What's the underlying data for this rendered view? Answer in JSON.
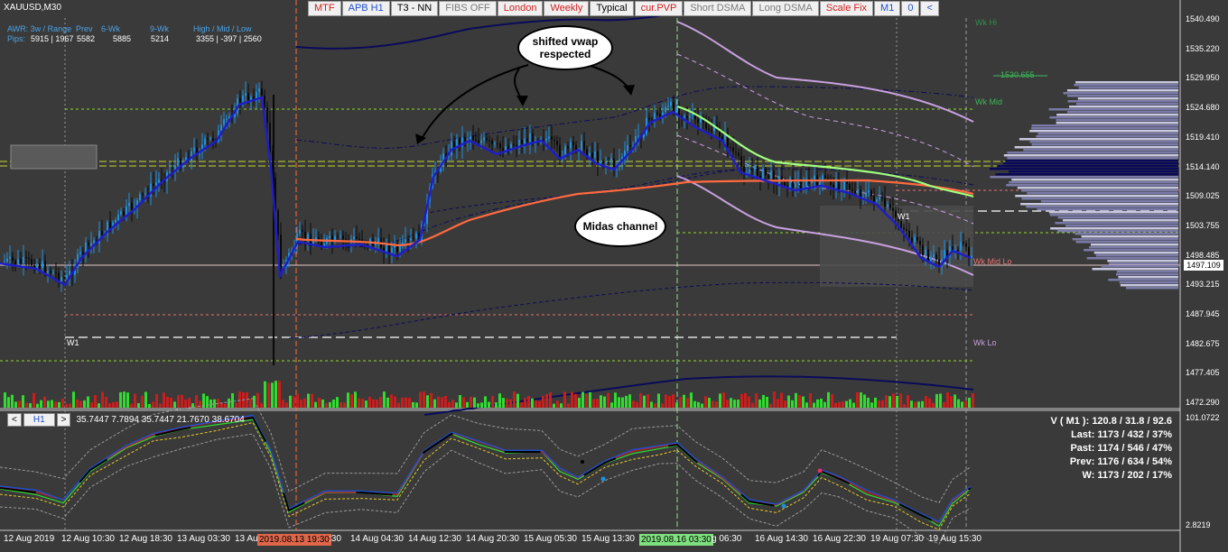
{
  "symbol": "XAUUSD,M30",
  "toolbar": [
    {
      "label": "MTF",
      "color": "#d02020"
    },
    {
      "label": "APB H1",
      "color": "#1e50d0"
    },
    {
      "label": "T3 - NN",
      "color": "#000000"
    },
    {
      "label": "FIBS OFF",
      "color": "#7a7a7a"
    },
    {
      "label": "London",
      "color": "#d02020"
    },
    {
      "label": "Weekly",
      "color": "#d02020"
    },
    {
      "label": "Typical",
      "color": "#000000"
    },
    {
      "label": "cur.PVP",
      "color": "#d02020"
    },
    {
      "label": "Short DSMA",
      "color": "#7a7a7a"
    },
    {
      "label": "Long DSMA",
      "color": "#7a7a7a"
    },
    {
      "label": "Scale Fix",
      "color": "#d02020"
    },
    {
      "label": "M1",
      "color": "#1e50d0"
    },
    {
      "label": "0",
      "color": "#1e50d0"
    },
    {
      "label": "<",
      "color": "#1e50d0"
    }
  ],
  "awr": {
    "row1": [
      "AWR: 3w / Range",
      "Prev",
      "6-Wk",
      "9-Wk",
      "High / Mid / Low"
    ],
    "row2_label": "Pips:",
    "row2": [
      "5915 | 1967",
      "5582",
      "5885",
      "5214",
      "3355 | -397 | 2560"
    ]
  },
  "price_axis": [
    "1540.490",
    "1535.220",
    "1529.950",
    "1524.680",
    "1519.410",
    "1514.140",
    "1509.025",
    "1503.755",
    "1498.485",
    "1493.215",
    "1487.945",
    "1482.675",
    "1477.405",
    "1472.290"
  ],
  "current_price": "1497.109",
  "level_labels": {
    "wk_hi": "Wk Hi",
    "wk_mid": "Wk Mid",
    "wk_mid_lo": "Wk Mid Lo",
    "wk_lo": "Wk Lo",
    "w1_left": "W1",
    "w1_right": "W1",
    "target": "1530.655"
  },
  "callouts": {
    "vwap": "shifted vwap respected",
    "midas": "Midas channel"
  },
  "subwindow": {
    "prev_btn": "<",
    "timeframe": "H1",
    "next_btn": ">",
    "values": "35.7447 7.7894 35.7447 21.7670 38.6704",
    "scale_top": "101.0722",
    "scale_bottom": "2.8219",
    "stats": [
      "V ( M1 ): 120.8 / 31.8 / 92.6",
      "Last: 1173 / 432 / 37%",
      "Past: 1174 / 546 / 47%",
      "Prev: 1176 / 634 / 54%",
      "W: 1173 / 202 / 17%"
    ]
  },
  "time_axis": [
    {
      "label": "12 Aug 2019",
      "hl": ""
    },
    {
      "label": "12 Aug 10:30",
      "hl": ""
    },
    {
      "label": "12 Aug 18:30",
      "hl": ""
    },
    {
      "label": "13 Aug 03:30",
      "hl": ""
    },
    {
      "label": "13 Au",
      "hl": ""
    },
    {
      "label": "2019.08.13 19:30",
      "hl": "#e0664a"
    },
    {
      "label": ":30",
      "hl": ""
    },
    {
      "label": "14 Aug 04:30",
      "hl": ""
    },
    {
      "label": "14 Aug 12:30",
      "hl": ""
    },
    {
      "label": "14 Aug 20:30",
      "hl": ""
    },
    {
      "label": "15 Aug 05:30",
      "hl": ""
    },
    {
      "label": "15 Aug 13:30",
      "hl": ""
    },
    {
      "label": "2019.08.16 03:30",
      "hl": "#7ee07e"
    },
    {
      "label": "g 06:30",
      "hl": ""
    },
    {
      "label": "16 Aug 14:30",
      "hl": ""
    },
    {
      "label": "16 Aug 22:30",
      "hl": ""
    },
    {
      "label": "19 Aug 07:30",
      "hl": ""
    },
    {
      "label": "19 Aug 15:30",
      "hl": ""
    }
  ],
  "colors": {
    "bg": "#3a3a3a",
    "bull": "#1e90e0",
    "bear": "#0a0a0a",
    "vwap": "#1e1ec8",
    "midas": "#ff6a40",
    "band": "#0a0a5a",
    "lavender": "#c8a0e0",
    "green": "#a0ff80",
    "vol_green": "#2fdc2f",
    "vol_red": "#c81e1e"
  }
}
